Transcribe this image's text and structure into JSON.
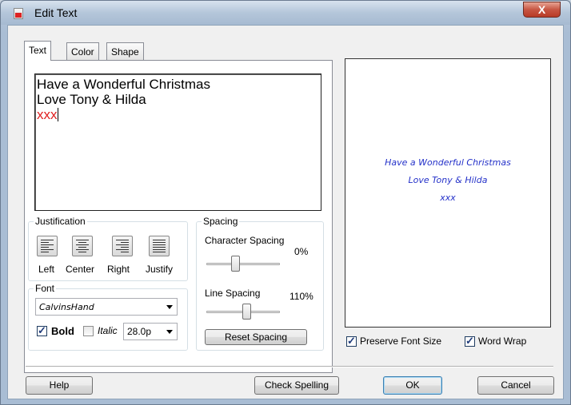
{
  "window": {
    "title": "Edit Text",
    "close_symbol": "X",
    "icon": "app-document-icon"
  },
  "tabs": [
    {
      "label": "Text",
      "active": true
    },
    {
      "label": "Color",
      "active": false
    },
    {
      "label": "Shape",
      "active": false
    }
  ],
  "editor": {
    "lines": [
      "Have a Wonderful Christmas",
      "Love Tony & Hilda",
      "xxx"
    ],
    "highlight_color": "#e02020"
  },
  "justification": {
    "label": "Justification",
    "buttons": [
      {
        "label": "Left",
        "icon": "align-left-icon"
      },
      {
        "label": "Center",
        "icon": "align-center-icon"
      },
      {
        "label": "Right",
        "icon": "align-right-icon"
      },
      {
        "label": "Justify",
        "icon": "align-justify-icon"
      }
    ]
  },
  "font": {
    "label": "Font",
    "family_value": "CalvinsHand",
    "bold_label": "Bold",
    "bold_checked": true,
    "italic_label": "Italic",
    "italic_checked": false,
    "size_value": "28.0p"
  },
  "spacing": {
    "label": "Spacing",
    "character_label": "Character Spacing",
    "character_value": "0%",
    "character_level": 0.4,
    "line_label": "Line Spacing",
    "line_value": "110%",
    "line_level": 0.55,
    "reset_label": "Reset Spacing"
  },
  "preview": {
    "lines": [
      "Have a Wonderful Christmas",
      "Love Tony & Hilda",
      "xxx"
    ],
    "text_color": "#2431c9"
  },
  "options": {
    "preserve_font_size_label": "Preserve Font Size",
    "preserve_font_size_checked": true,
    "word_wrap_label": "Word Wrap",
    "word_wrap_checked": true
  },
  "buttons": {
    "help": "Help",
    "check_spelling": "Check Spelling",
    "ok": "OK",
    "cancel": "Cancel"
  }
}
